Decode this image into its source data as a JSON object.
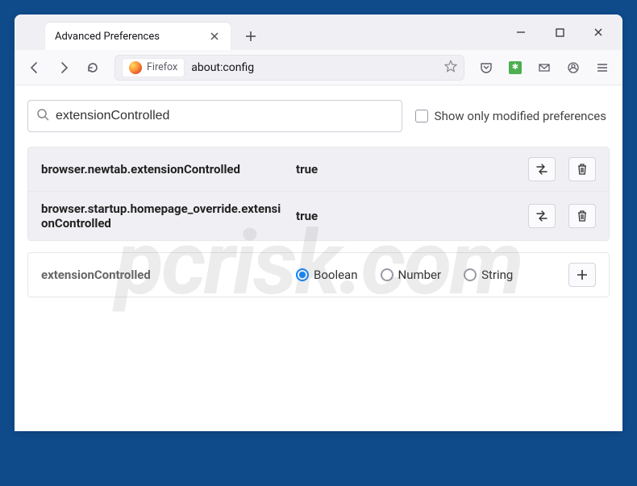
{
  "tab": {
    "title": "Advanced Preferences"
  },
  "urlbar": {
    "identity_label": "Firefox",
    "url": "about:config"
  },
  "search": {
    "value": "extensionControlled",
    "show_only_label": "Show only modified preferences"
  },
  "prefs": [
    {
      "name": "browser.newtab.extensionControlled",
      "value": "true"
    },
    {
      "name": "browser.startup.homepage_override.extensionControlled",
      "value": "true"
    }
  ],
  "new_pref": {
    "name": "extensionControlled",
    "types": [
      "Boolean",
      "Number",
      "String"
    ],
    "selected": "Boolean"
  },
  "watermark": "pcrisk.com"
}
